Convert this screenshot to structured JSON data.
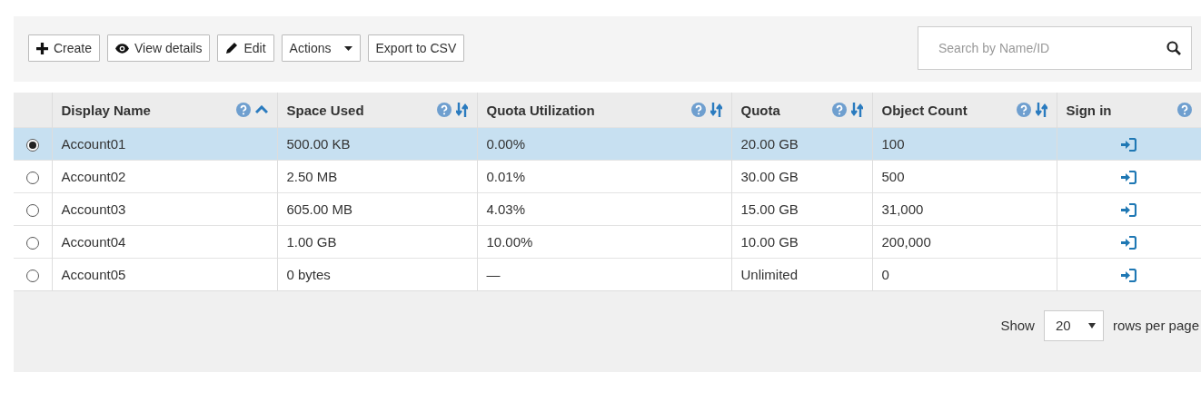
{
  "toolbar": {
    "buttons": [
      {
        "label": "Create",
        "kind": "plus"
      },
      {
        "label": "View details",
        "kind": "eye"
      },
      {
        "label": "Edit",
        "kind": "pencil"
      },
      {
        "label": "Actions",
        "kind": "dropdown"
      },
      {
        "label": "Export to CSV",
        "kind": "plain"
      }
    ],
    "search": {
      "placeholder": "Search by Name/ID"
    }
  },
  "table": {
    "columns": [
      {
        "label": "Display Name",
        "help": true,
        "kind": "sorted"
      },
      {
        "label": "Space Used",
        "help": true,
        "kind": "sortable"
      },
      {
        "label": "Quota Utilization",
        "help": true,
        "kind": "sortable"
      },
      {
        "label": "Quota",
        "help": true,
        "kind": "sortable"
      },
      {
        "label": "Object Count",
        "help": true,
        "kind": "sortable"
      },
      {
        "label": "Sign in",
        "help": true,
        "kind": "plain"
      }
    ],
    "rows": [
      {
        "selected": true,
        "cells": [
          "Account01",
          "500.00 KB",
          "0.00%",
          "20.00 GB",
          "100"
        ]
      },
      {
        "selected": false,
        "cells": [
          "Account02",
          "2.50 MB",
          "0.01%",
          "30.00 GB",
          "500"
        ]
      },
      {
        "selected": false,
        "cells": [
          "Account03",
          "605.00 MB",
          "4.03%",
          "15.00 GB",
          "31,000"
        ]
      },
      {
        "selected": false,
        "cells": [
          "Account04",
          "1.00 GB",
          "10.00%",
          "10.00 GB",
          "200,000"
        ]
      },
      {
        "selected": false,
        "cells": [
          "Account05",
          "0 bytes",
          "—",
          "Unlimited",
          "0"
        ]
      }
    ]
  },
  "footer": {
    "show_label": "Show",
    "page_size": "20",
    "suffix": "rows per page"
  }
}
